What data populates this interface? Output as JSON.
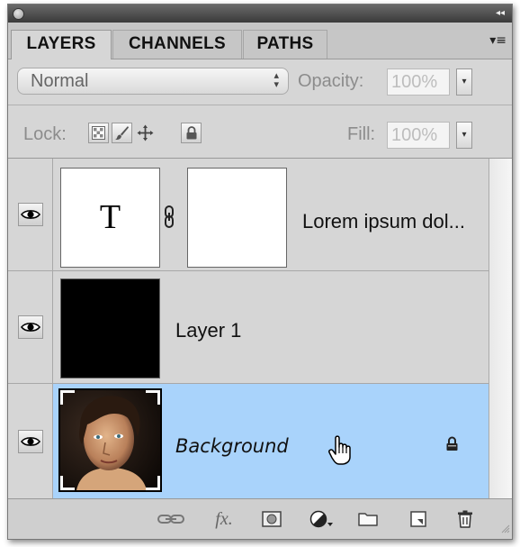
{
  "tabs": [
    {
      "label": "LAYERS",
      "active": true
    },
    {
      "label": "CHANNELS",
      "active": false
    },
    {
      "label": "PATHS",
      "active": false
    }
  ],
  "blend": {
    "mode": "Normal",
    "opacity_label": "Opacity:",
    "opacity_value": "100%"
  },
  "lock": {
    "label": "Lock:",
    "fill_label": "Fill:",
    "fill_value": "100%"
  },
  "layers": [
    {
      "name": "Lorem ipsum dol...",
      "type": "text",
      "thumb_letter": "T",
      "visible": true,
      "selected": false
    },
    {
      "name": "Layer 1",
      "type": "fill",
      "visible": true,
      "selected": false
    },
    {
      "name": "Background",
      "type": "image",
      "visible": true,
      "selected": true,
      "locked": true
    }
  ],
  "bottom_icons": [
    "link-layers-icon",
    "fx-icon",
    "add-mask-icon",
    "adjustment-layer-icon",
    "new-group-icon",
    "new-layer-icon",
    "trash-icon"
  ],
  "colors": {
    "selected_row": "#a9d3fb",
    "panel_bg": "#d6d6d6",
    "titlebar": "#4a4a4a"
  }
}
